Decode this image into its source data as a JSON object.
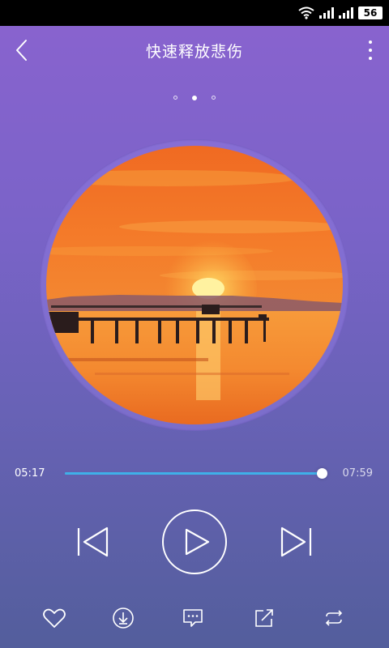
{
  "status_bar": {
    "battery": "56",
    "icons": [
      "wifi-icon",
      "signal-icon",
      "signal-2-icon",
      "battery-icon"
    ]
  },
  "header": {
    "title": "快速释放悲伤",
    "back_icon": "chevron-left-icon",
    "more_icon": "more-vertical-icon"
  },
  "pager": {
    "count": 3,
    "active_index": 1
  },
  "player": {
    "current_time": "05:17",
    "total_time": "07:59",
    "progress": 0.99
  },
  "controls": [
    "previous-icon",
    "play-icon",
    "next-icon"
  ],
  "bottom_actions": [
    "heart-icon",
    "download-icon",
    "comment-icon",
    "share-icon",
    "repeat-icon"
  ],
  "colors": {
    "accent": "#3fb0e8",
    "bg_top": "#8a63cf",
    "bg_bottom": "#535e9c"
  }
}
